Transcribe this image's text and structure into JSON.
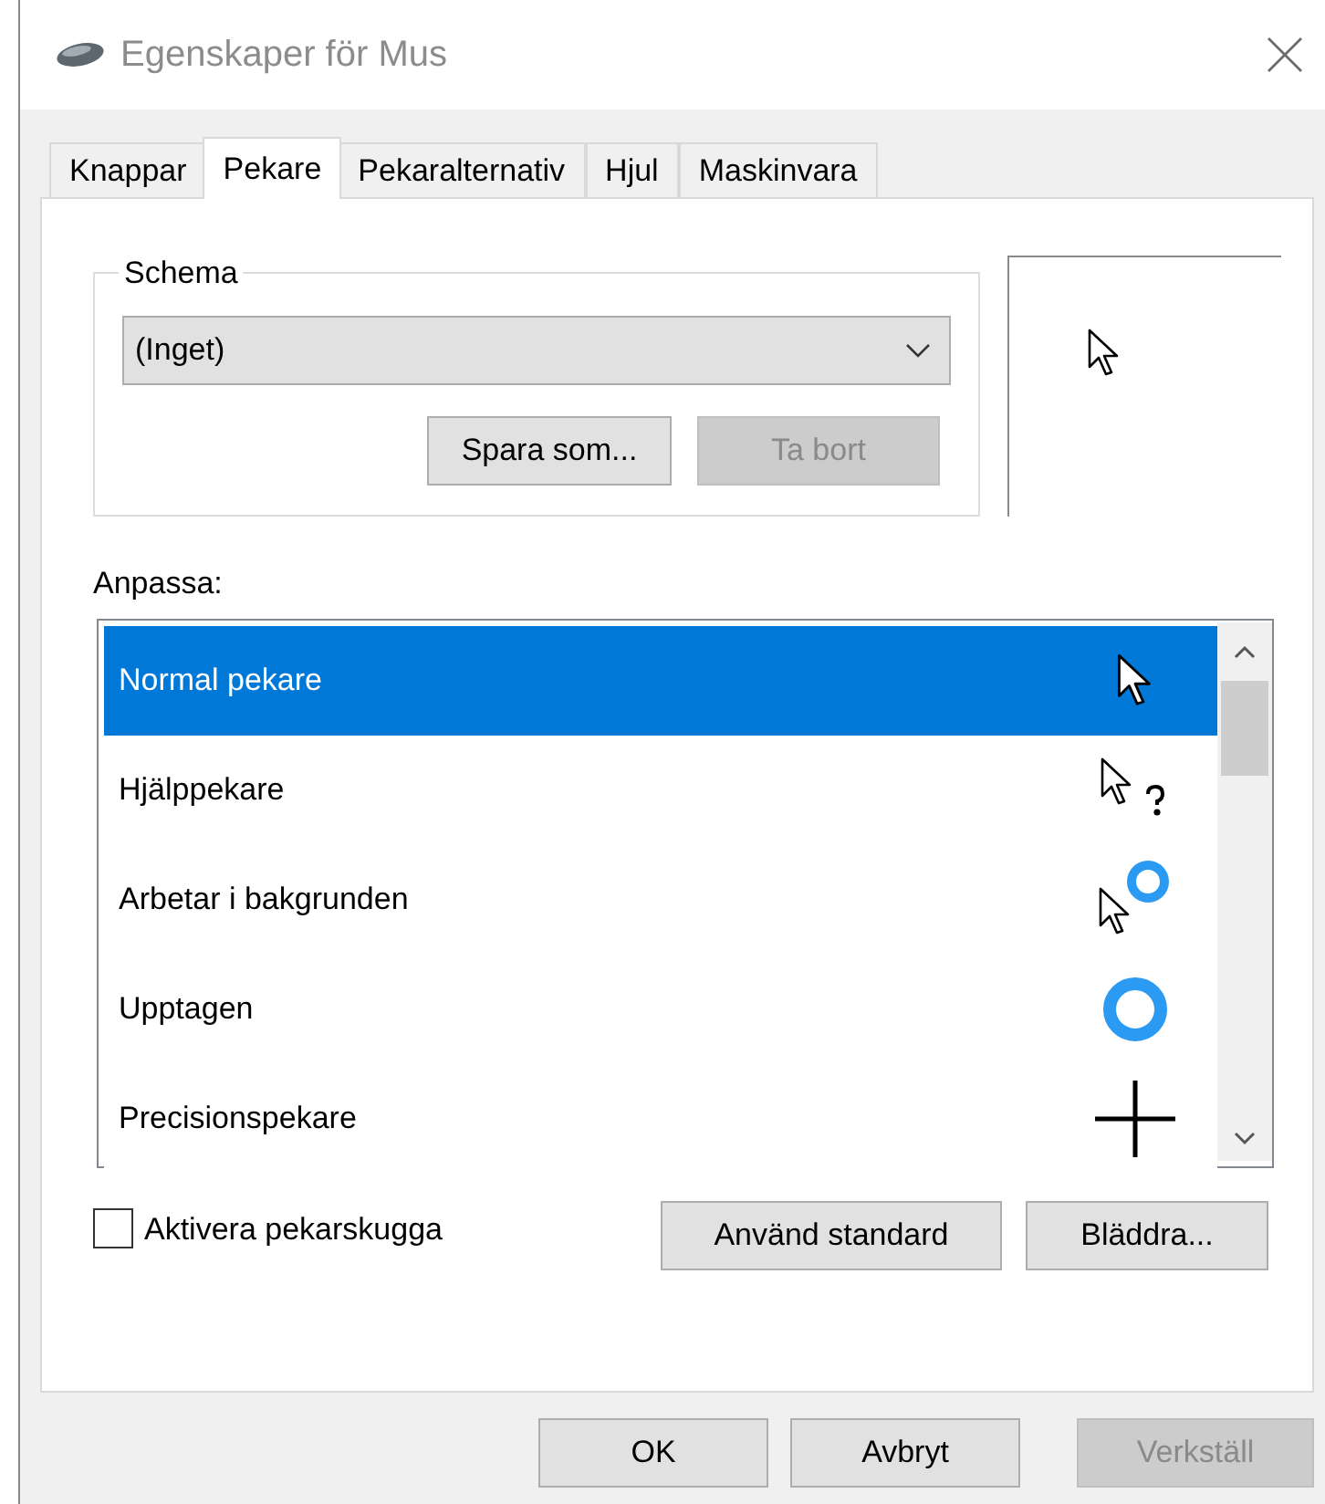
{
  "window": {
    "title": "Egenskaper för Mus"
  },
  "tabs": [
    {
      "label": "Knappar",
      "selected": false
    },
    {
      "label": "Pekare",
      "selected": true
    },
    {
      "label": "Pekaralternativ",
      "selected": false
    },
    {
      "label": "Hjul",
      "selected": false
    },
    {
      "label": "Maskinvara",
      "selected": false
    }
  ],
  "scheme": {
    "label": "Schema",
    "value": "(Inget)",
    "buttons": [
      {
        "label": "Spara som...",
        "disabled": false
      },
      {
        "label": "Ta bort",
        "disabled": true
      }
    ]
  },
  "customize": {
    "label": "Anpassa:",
    "items": [
      {
        "label": "Normal pekare",
        "kind": "arrow",
        "selected": true
      },
      {
        "label": "Hjälppekare",
        "kind": "help",
        "selected": false
      },
      {
        "label": "Arbetar i bakgrunden",
        "kind": "working",
        "selected": false
      },
      {
        "label": "Upptagen",
        "kind": "busy",
        "selected": false
      },
      {
        "label": "Precisionspekare",
        "kind": "cross",
        "selected": false
      }
    ]
  },
  "shadow": {
    "label": "Aktivera pekarskugga",
    "checked": false
  },
  "list_buttons": [
    {
      "label": "Använd standard",
      "disabled": false
    },
    {
      "label": "Bläddra...",
      "disabled": false
    }
  ],
  "dialog_buttons": [
    {
      "label": "OK",
      "disabled": false
    },
    {
      "label": "Avbryt",
      "disabled": false
    },
    {
      "label": "Verkställ",
      "disabled": true
    }
  ]
}
